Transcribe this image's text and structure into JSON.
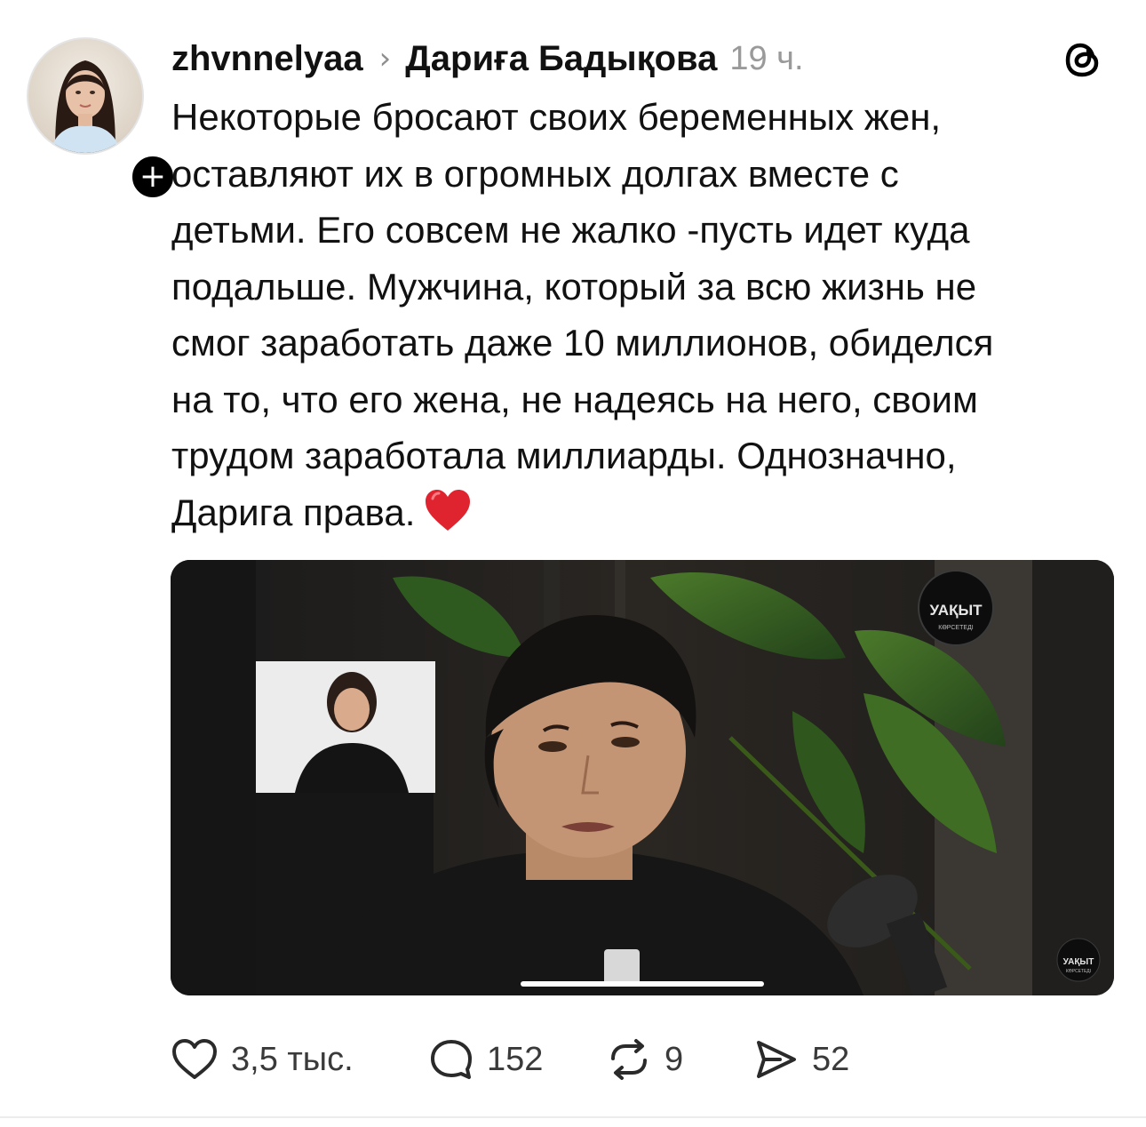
{
  "post": {
    "username": "zhvnnelyaa",
    "reply_to": "Дариға Бадықова",
    "timestamp": "19 ч.",
    "text": "Некоторые бросают своих беременных жен,\nоставляют их в огромных долгах вместе с\nдетьми. Его совсем не жалко -пусть идет куда\nподальше. Мужчина, который за всю жизнь не\nсмог заработать даже 10 миллионов, обиделся\nна то, что его жена, не надеясь на него, своим\nтрудом заработала миллиарды. Однозначно,\nДарига права.",
    "emoji": "heart-emoji",
    "follow_symbol": "+",
    "chevron": "›"
  },
  "media": {
    "watermark_top": "УАҚЫТ",
    "watermark_top_sub": "КӨРСЕТЕДІ",
    "watermark_bottom": "УАҚЫТ",
    "watermark_bottom_sub": "КӨРСЕТЕДІ"
  },
  "actions": {
    "likes": "3,5 тыс.",
    "comments": "152",
    "reposts": "9",
    "shares": "52"
  },
  "colors": {
    "text": "#111111",
    "secondary": "#9a9a9a",
    "heart": "#e0242f"
  }
}
